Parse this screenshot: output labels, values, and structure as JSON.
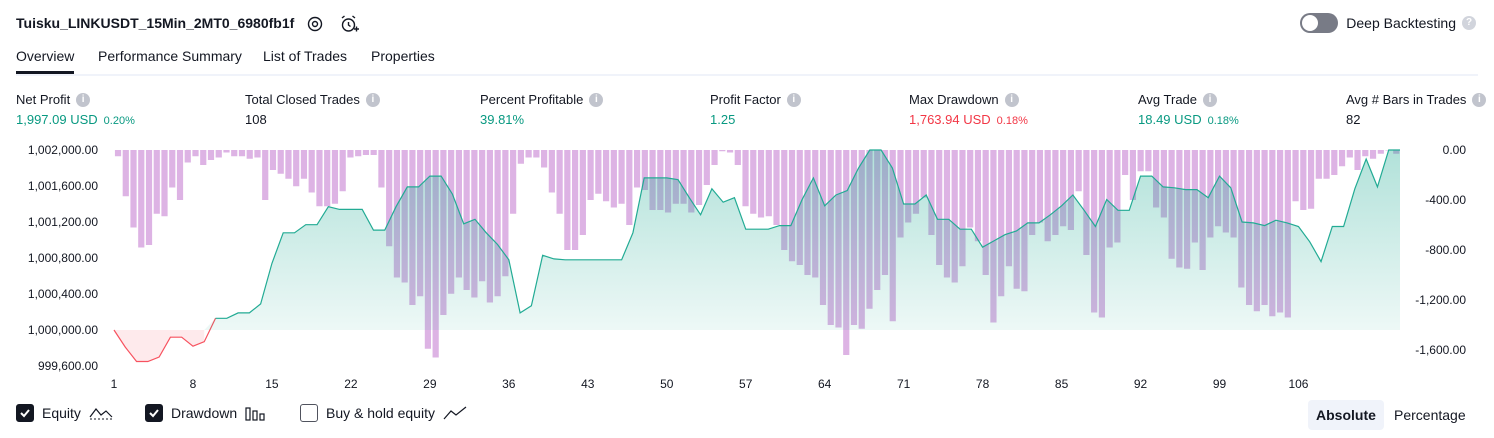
{
  "header": {
    "title": "Tuisku_LINKUSDT_15Min_2MT0_6980fb1f",
    "deep_backtesting_label": "Deep Backtesting",
    "deep_backtesting_enabled": false
  },
  "tabs": [
    {
      "label": "Overview",
      "active": true
    },
    {
      "label": "Performance Summary",
      "active": false
    },
    {
      "label": "List of Trades",
      "active": false
    },
    {
      "label": "Properties",
      "active": false
    }
  ],
  "metrics": [
    {
      "label": "Net Profit",
      "value": "1,997.09 USD",
      "pct": "0.20%",
      "tone": "pos"
    },
    {
      "label": "Total Closed Trades",
      "value": "108",
      "pct": "",
      "tone": "plain"
    },
    {
      "label": "Percent Profitable",
      "value": "39.81%",
      "pct": "",
      "tone": "pos"
    },
    {
      "label": "Profit Factor",
      "value": "1.25",
      "pct": "",
      "tone": "pos"
    },
    {
      "label": "Max Drawdown",
      "value": "1,763.94 USD",
      "pct": "0.18%",
      "tone": "neg"
    },
    {
      "label": "Avg Trade",
      "value": "18.49 USD",
      "pct": "0.18%",
      "tone": "pos"
    },
    {
      "label": "Avg # Bars in Trades",
      "value": "82",
      "pct": "",
      "tone": "plain"
    }
  ],
  "chart_data": {
    "type": "line",
    "title": "",
    "baseline": 1000000,
    "colors": {
      "equity_line": "#22ab94",
      "equity_fill": "#22ab94",
      "below_line": "#f7525f",
      "drawdown_bar": "#ce93d8"
    },
    "x_ticks": [
      "1",
      "8",
      "15",
      "22",
      "29",
      "36",
      "43",
      "50",
      "57",
      "64",
      "71",
      "78",
      "85",
      "92",
      "99",
      "106"
    ],
    "left_axis": {
      "ticks": [
        "1,002,000.00",
        "1,001,600.00",
        "1,001,200.00",
        "1,000,800.00",
        "1,000,400.00",
        "1,000,000.00",
        "999,600.00"
      ],
      "ylim": [
        999500,
        1002000
      ]
    },
    "right_axis": {
      "ticks": [
        "0.00",
        "-400.00",
        "-800.00",
        "-1,200.00",
        "-1,600.00"
      ],
      "ylim": [
        -1800,
        0
      ]
    },
    "series": [
      {
        "name": "Equity",
        "values": [
          1000000,
          999810,
          999650,
          999650,
          999700,
          999920,
          999920,
          999820,
          999870,
          1000130,
          1000130,
          1000190,
          1000190,
          1000290,
          1000740,
          1001080,
          1001080,
          1001170,
          1001170,
          1001370,
          1001340,
          1001340,
          1001340,
          1001110,
          1001110,
          1001370,
          1001590,
          1001590,
          1001710,
          1001710,
          1001510,
          1001180,
          1001230,
          1001080,
          1000950,
          1000780,
          1000190,
          1000270,
          1000830,
          1000790,
          1000780,
          1000780,
          1000780,
          1000780,
          1000780,
          1000780,
          1001080,
          1001690,
          1001690,
          1001690,
          1001670,
          1001470,
          1001280,
          1001570,
          1001420,
          1001470,
          1001120,
          1001120,
          1001120,
          1001160,
          1001160,
          1001450,
          1001690,
          1001380,
          1001500,
          1001550,
          1001800,
          1002000,
          1002000,
          1001800,
          1001400,
          1001400,
          1001500,
          1001230,
          1001230,
          1001120,
          1001120,
          1000920,
          1000990,
          1001060,
          1001100,
          1001190,
          1001190,
          1001280,
          1001380,
          1001500,
          1001330,
          1001150,
          1001450,
          1001330,
          1001330,
          1001710,
          1001710,
          1001590,
          1001580,
          1001560,
          1001560,
          1001470,
          1001710,
          1001580,
          1001200,
          1001190,
          1001160,
          1001220,
          1001190,
          1001150,
          1000980,
          1000760,
          1001150,
          1001150,
          1001570,
          1001900,
          1001590,
          1002000,
          1002000
        ]
      },
      {
        "name": "Drawdown",
        "values": [
          -50,
          -370,
          -620,
          -780,
          -760,
          -510,
          -530,
          -300,
          -400,
          -100,
          -50,
          -120,
          -80,
          -60,
          -20,
          -50,
          -50,
          -70,
          -60,
          -400,
          -160,
          -190,
          -230,
          -290,
          -230,
          -340,
          -450,
          -450,
          -430,
          -330,
          -60,
          -50,
          -40,
          -40,
          -300,
          -770,
          -1020,
          -1060,
          -1240,
          -1170,
          -1590,
          -1660,
          -1320,
          -1150,
          -1020,
          -1120,
          -1180,
          -1050,
          -1220,
          -1170,
          -1010,
          -510,
          -110,
          -60,
          -60,
          -140,
          -340,
          -510,
          -800,
          -800,
          -680,
          -400,
          -350,
          -410,
          -460,
          -430,
          -600,
          -300,
          -320,
          -480,
          -480,
          -500,
          -430,
          -430,
          -500,
          -440,
          -280,
          -120,
          -10,
          -20,
          -120,
          -450,
          -510,
          -540,
          -530,
          -600,
          -800,
          -890,
          -920,
          -1000,
          -1020,
          -1240,
          -1400,
          -1420,
          -1640,
          -1400,
          -1430,
          -1270,
          -1120,
          -1000,
          -1370,
          -700,
          -580,
          -510,
          -380,
          -680,
          -920,
          -1020,
          -1060,
          -930,
          -620,
          -730,
          -1000,
          -1380,
          -1170,
          -930,
          -1110,
          -1130,
          -680,
          -580,
          -730,
          -680,
          -610,
          -640,
          -330,
          -840,
          -1300,
          -1340,
          -780,
          -740,
          -200,
          -400,
          -170,
          -170,
          -460,
          -540,
          -870,
          -940,
          -950,
          -740,
          -960,
          -700,
          -610,
          -660,
          -700,
          -1100,
          -1240,
          -1290,
          -1240,
          -1330,
          -1300,
          -1340,
          -410,
          -480,
          -470,
          -230,
          -230,
          -200,
          -130,
          -60,
          -160,
          -50,
          -70,
          -30,
          0,
          -30
        ]
      }
    ]
  },
  "footer": {
    "equity_label": "Equity",
    "drawdown_label": "Drawdown",
    "buyhold_label": "Buy & hold equity",
    "equity_checked": true,
    "drawdown_checked": true,
    "buyhold_checked": false,
    "absolute_label": "Absolute",
    "percentage_label": "Percentage",
    "active_mode": "Absolute"
  }
}
